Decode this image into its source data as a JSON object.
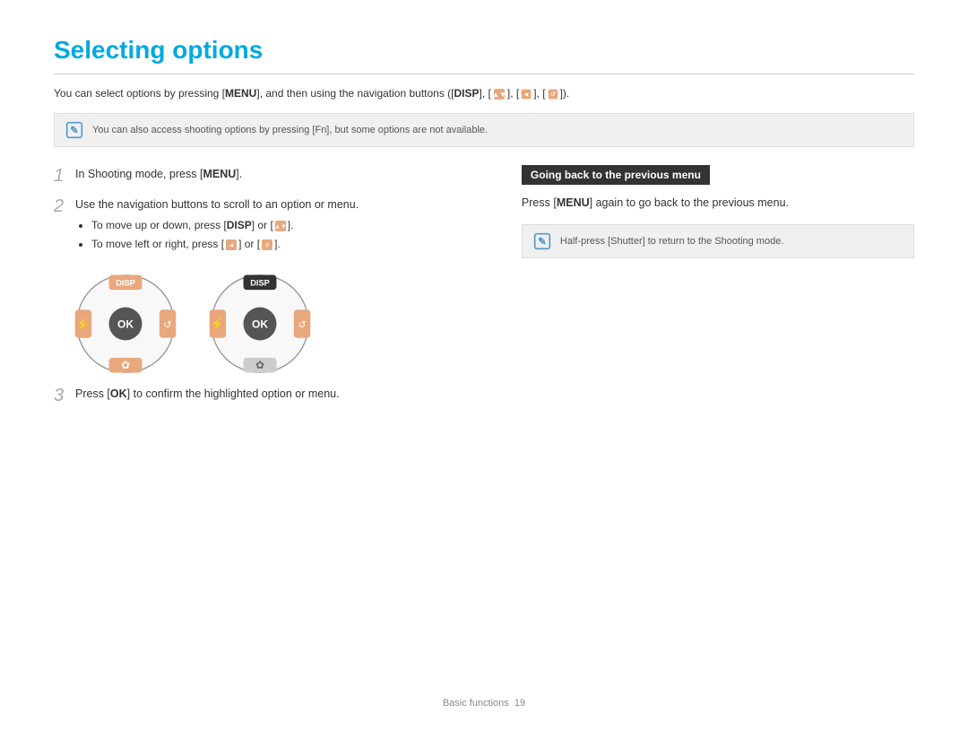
{
  "page": {
    "title": "Selecting options",
    "divider": true,
    "intro": {
      "text_before_menu": "You can select options by pressing [",
      "menu_key": "MENU",
      "text_after_menu": "], and then using the navigation buttons ([",
      "disp_key": "DISP",
      "rest": "], [▲▼], [◄], [↺])."
    },
    "note1": {
      "icon": "info-icon",
      "text": "You can also access shooting options by pressing [Fn], but some options are not available."
    },
    "steps": [
      {
        "num": "1",
        "text_before": "In Shooting mode, press [",
        "key": "MENU",
        "text_after": "]."
      },
      {
        "num": "2",
        "text_before": "Use the navigation buttons to scroll to an option or menu.",
        "bullets": [
          "To move up or down, press [DISP] or [▲▼].",
          "To move left or right, press [◄] or [↺]."
        ]
      },
      {
        "num": "3",
        "text_before": "Press [",
        "key": "OK",
        "text_after": "] to confirm the highlighted option or menu."
      }
    ],
    "previous_menu": {
      "title": "Going back to the previous menu",
      "text_before": "Press [",
      "key": "MENU",
      "text_after": "] again to go back to the previous menu.",
      "note": {
        "icon": "info-icon",
        "text": "Half-press [Shutter] to return to the Shooting mode."
      }
    },
    "footer": {
      "text": "Basic functions",
      "page": "19"
    }
  }
}
